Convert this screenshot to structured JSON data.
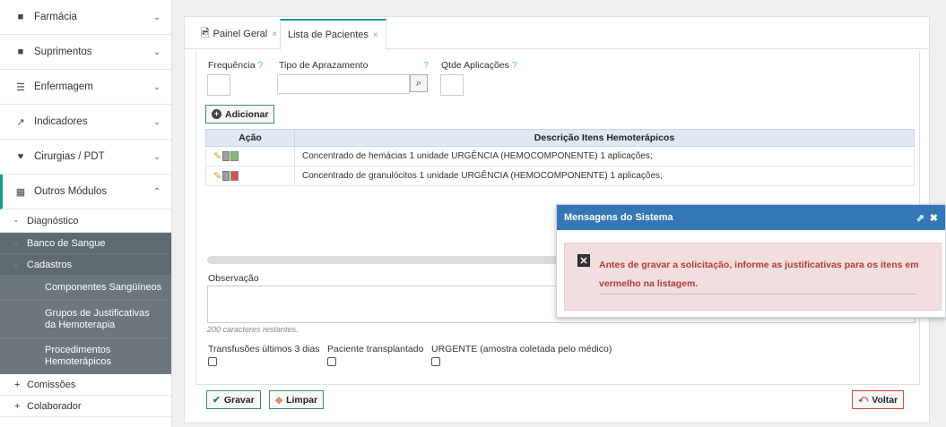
{
  "sidebar": {
    "items": [
      {
        "icon": "plus-square-icon",
        "label": "Farmácia",
        "chevron": "⌄"
      },
      {
        "icon": "box-icon",
        "label": "Suprimentos",
        "chevron": "⌄"
      },
      {
        "icon": "list-icon",
        "label": "Enfermagem",
        "chevron": "⌄"
      },
      {
        "icon": "line-chart-icon",
        "label": "Indicadores",
        "chevron": "⌄"
      },
      {
        "icon": "heartbeat-icon",
        "label": "Cirurgias / PDT",
        "chevron": "⌄"
      },
      {
        "icon": "grid-icon",
        "label": "Outros Módulos",
        "chevron": "⌃"
      }
    ],
    "sub": {
      "diagnostico": "Diagnóstico",
      "banco_sangue": "Banco de Sangue",
      "cadastros": "Cadastros",
      "componentes": "Componentes Sangüíneos",
      "grupos": "Grupos de Justificativas da Hemoterapia",
      "procedimentos": "Procedimentos Hemoterápicos",
      "comissoes": "Comissões",
      "colaborador": "Colaborador"
    }
  },
  "tabs": [
    {
      "label": "Painel Geral",
      "close": "×"
    },
    {
      "label": "Lista de Pacientes",
      "close": "×"
    }
  ],
  "form": {
    "frequencia_label": "Frequência",
    "tipo_aprazamento_label": "Tipo de Aprazamento",
    "qtde_aplicacoes_label": "Qtde Aplicações",
    "help_mark": "?",
    "adicionar_label": "Adicionar",
    "observacao_label": "Observação",
    "chars_remaining": "200 caracteres restantes.",
    "checkboxes": {
      "transfusoes": "Transfusões últimos 3 dias",
      "transplantado": "Paciente transplantado",
      "urgente": "URGENTE (amostra coletada pelo médico)"
    }
  },
  "table": {
    "headers": {
      "acao": "Ação",
      "descricao": "Descrição Itens Hemoterápicos"
    },
    "rows": [
      {
        "descricao": "Concentrado de hemácias 1 unidade URGÊNCIA (HEMOCOMPONENTE) 1 aplicações;",
        "flag_color": "#7fbf6a"
      },
      {
        "descricao": "Concentrado de granulócitos 1 unidade URGÊNCIA (HEMOCOMPONENTE) 1 aplicações;",
        "flag_color": "#d9534f"
      }
    ]
  },
  "buttons": {
    "gravar": "Gravar",
    "limpar": "Limpar",
    "voltar": "Voltar"
  },
  "dialog": {
    "title": "Mensagens do Sistema",
    "message": "Antes de gravar a solicitação, informe as justificativas para os itens em vermelho na listagem."
  },
  "colors": {
    "accent": "#18a08b",
    "dialog_header": "#3377b6",
    "error_text": "#b13b3b"
  }
}
